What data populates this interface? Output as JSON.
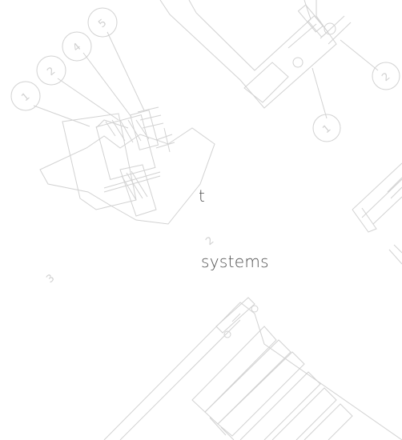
{
  "text_fragments": [
    "t",
    "systems"
  ],
  "callouts": {
    "left_group": [
      "1",
      "2",
      "4",
      "5"
    ],
    "right_group": [
      "2",
      "1"
    ],
    "floating": [
      "2",
      "3"
    ]
  },
  "colors": {
    "background": "#ffffff",
    "line_art": "#cfcfcf",
    "text": "#4f4f4f"
  }
}
